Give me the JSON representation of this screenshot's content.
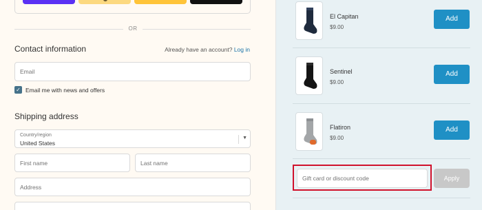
{
  "express": {
    "buttons": [
      "shop-pay",
      "amazon-pay",
      "paypal",
      "google-pay"
    ]
  },
  "divider": {
    "or_label": "OR"
  },
  "contact": {
    "title": "Contact information",
    "account_prompt": "Already have an account?",
    "login_link": "Log in",
    "email_placeholder": "Email",
    "newsletter_label": "Email me with news and offers",
    "newsletter_checked": true
  },
  "shipping": {
    "title": "Shipping address",
    "country_label": "Country/region",
    "country_value": "United States",
    "first_name_placeholder": "First name",
    "last_name_placeholder": "Last name",
    "address_placeholder": "Address"
  },
  "products": [
    {
      "name": "El Capitan",
      "price": "$9.00",
      "button": "Add",
      "sock_color": "#1f2b3d"
    },
    {
      "name": "Sentinel",
      "price": "$9.00",
      "button": "Add",
      "sock_color": "#141414"
    },
    {
      "name": "Flatiron",
      "price": "$9.00",
      "button": "Add",
      "sock_color": "#a3a6a8"
    }
  ],
  "discount": {
    "placeholder": "Gift card or discount code",
    "apply_label": "Apply"
  },
  "colors": {
    "left_bg": "#fffaf3",
    "right_bg": "#e8f1f4",
    "primary_button": "#1f90c5",
    "highlight_outline": "#d0112b"
  }
}
